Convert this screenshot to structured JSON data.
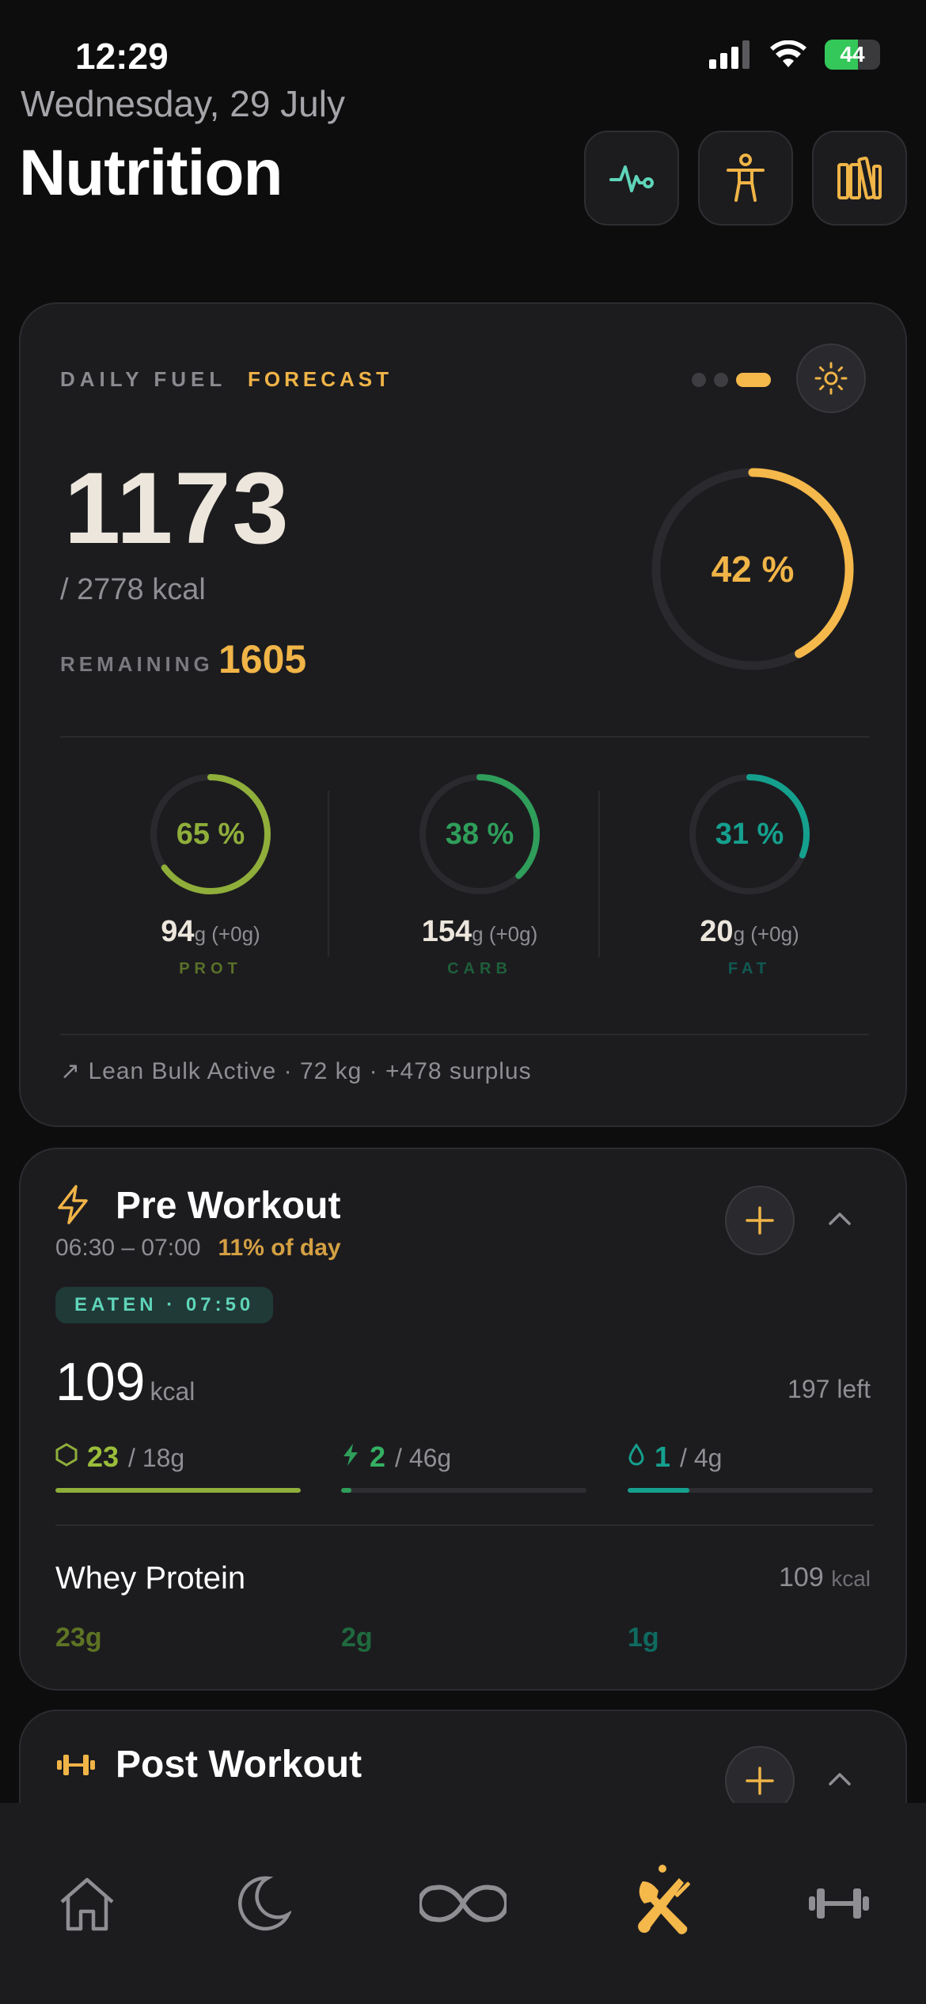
{
  "status": {
    "time": "12:29",
    "battery": "44"
  },
  "header": {
    "date": "Wednesday, 29 July",
    "title": "Nutrition"
  },
  "colors": {
    "accent": "#f0b447",
    "protein": "#8fae3a",
    "carb": "#2f9e5a",
    "fat": "#15a08e",
    "background": "#0d0d0e",
    "card": "#1c1c1f"
  },
  "header_buttons": [
    {
      "icon": "heartbeat-icon"
    },
    {
      "icon": "body-figure-icon"
    },
    {
      "icon": "library-icon"
    }
  ],
  "daily_fuel": {
    "label": "DAILY FUEL",
    "mode": "FORECAST",
    "page_indicator": {
      "count": 3,
      "active": 2
    },
    "consumed": "1173",
    "target": "/ 2778 kcal",
    "remaining_label": "REMAINING",
    "remaining_value": "1605",
    "percent_text": "42 %",
    "percent": 0.42,
    "macros": [
      {
        "key": "protein",
        "percent_text": "65 %",
        "percent": 0.65,
        "value": "94",
        "unit": "g (+0g)",
        "label": "PROT"
      },
      {
        "key": "carb",
        "percent_text": "38 %",
        "percent": 0.38,
        "value": "154",
        "unit": "g (+0g)",
        "label": "CARB"
      },
      {
        "key": "fat",
        "percent_text": "31 %",
        "percent": 0.31,
        "value": "20",
        "unit": "g (+0g)",
        "label": "FAT"
      }
    ],
    "mode_line": "↗ Lean Bulk Active · 72 kg · +478 surplus"
  },
  "pre_workout": {
    "title": "Pre Workout",
    "time": "06:30 – 07:00",
    "day_pct": "11% of day",
    "badge": "EATEN · 07:50",
    "kcal": "109",
    "kcal_unit": "kcal",
    "left": "197 left",
    "stats": [
      {
        "key": "protein",
        "value": "23",
        "of": "/ 18g",
        "progress": 1.0
      },
      {
        "key": "carb",
        "value": "2",
        "of": "/ 46g",
        "progress": 0.043
      },
      {
        "key": "fat",
        "value": "1",
        "of": "/ 4g",
        "progress": 0.25
      }
    ],
    "foods": [
      {
        "name": "Whey Protein",
        "kcal": "109",
        "kcal_unit": "kcal",
        "protein": "23g",
        "carb": "2g",
        "fat": "1g"
      }
    ]
  },
  "post_workout": {
    "title": "Post Workout"
  },
  "tabbar": {
    "tabs": [
      {
        "icon": "home-icon"
      },
      {
        "icon": "moon-icon"
      },
      {
        "icon": "infinity-icon"
      },
      {
        "icon": "fork-knife-icon",
        "active": true
      },
      {
        "icon": "dumbbell-icon"
      }
    ]
  }
}
